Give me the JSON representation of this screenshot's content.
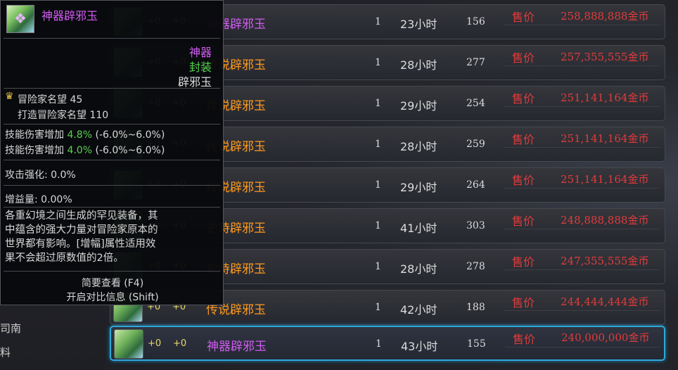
{
  "left_panel": {
    "labels": [
      "司南",
      "料"
    ]
  },
  "listings": [
    {
      "plus1": "+0",
      "plus2": "+0",
      "name": "神器辟邪玉",
      "name_type": "god",
      "qty": "1",
      "time": "23小时",
      "num": "156",
      "price_label": "售价",
      "price": "258,888,888",
      "unit": "金币"
    },
    {
      "plus1": "+0",
      "plus2": "+0",
      "name": "传说辟邪玉",
      "name_type": "legend",
      "qty": "1",
      "time": "28小时",
      "num": "277",
      "price_label": "售价",
      "price": "257,355,555",
      "unit": "金币"
    },
    {
      "plus1": "+0",
      "plus2": "+0",
      "name": "传说辟邪玉",
      "name_type": "legend",
      "qty": "1",
      "time": "29小时",
      "num": "254",
      "price_label": "售价",
      "price": "251,141,164",
      "unit": "金币"
    },
    {
      "plus1": "+0",
      "plus2": "+0",
      "name": "传说辟邪玉",
      "name_type": "legend",
      "qty": "1",
      "time": "28小时",
      "num": "259",
      "price_label": "售价",
      "price": "251,141,164",
      "unit": "金币"
    },
    {
      "plus1": "+0",
      "plus2": "+0",
      "name": "传说辟邪玉",
      "name_type": "legend",
      "qty": "1",
      "time": "29小时",
      "num": "264",
      "price_label": "售价",
      "price": "251,141,164",
      "unit": "金币"
    },
    {
      "plus1": "+0",
      "plus2": "+0",
      "name": "史诗辟邪玉",
      "name_type": "legend",
      "qty": "1",
      "time": "41小时",
      "num": "303",
      "price_label": "售价",
      "price": "248,888,888",
      "unit": "金币"
    },
    {
      "plus1": "+0",
      "plus2": "+0",
      "name": "史诗辟邪玉",
      "name_type": "legend",
      "qty": "1",
      "time": "28小时",
      "num": "278",
      "price_label": "售价",
      "price": "247,355,555",
      "unit": "金币"
    },
    {
      "plus1": "+0",
      "plus2": "+0",
      "name": "传说辟邪玉",
      "name_type": "legend",
      "qty": "1",
      "time": "42小时",
      "num": "188",
      "price_label": "售价",
      "price": "244,444,444",
      "unit": "金币"
    },
    {
      "plus1": "+0",
      "plus2": "+0",
      "name": "神器辟邪玉",
      "name_type": "god",
      "qty": "1",
      "time": "43小时",
      "num": "155",
      "price_label": "售价",
      "price": "240,000,000",
      "unit": "金币",
      "selected": true
    }
  ],
  "tooltip": {
    "title": "神器辟邪玉",
    "rarity": "神器",
    "sealed": "封装",
    "type": "辟邪玉",
    "adventurer_fame_label": "冒险家名望",
    "adventurer_fame_value": "45",
    "forge_fame_label": "打造冒险家名望",
    "forge_fame_value": "110",
    "skill_dmg_label": "技能伤害增加",
    "skill_dmg_1": "4.8%",
    "skill_dmg_1_range": "(-6.0%~6.0%)",
    "skill_dmg_2": "4.0%",
    "skill_dmg_2_range": "(-6.0%~6.0%)",
    "attack_enhance": "攻击强化: 0.0%",
    "buff_amount": "增益量: 0.00%",
    "description_lines": [
      "各重幻境之间生成的罕见装备，其",
      "中蕴含的强大力量对冒险家原本的",
      "世界都有影响。[增幅]属性适用效",
      "果不会超过原数值的2倍。"
    ],
    "footer_summary": "简要查看 (F4)",
    "footer_compare": "开启对比信息 (Shift)"
  },
  "colors": {
    "god": "#d05cf0",
    "legend": "#ff9a1e",
    "price": "#e23b3b",
    "green": "#58d24f",
    "selected_border": "#2fa8d8"
  }
}
